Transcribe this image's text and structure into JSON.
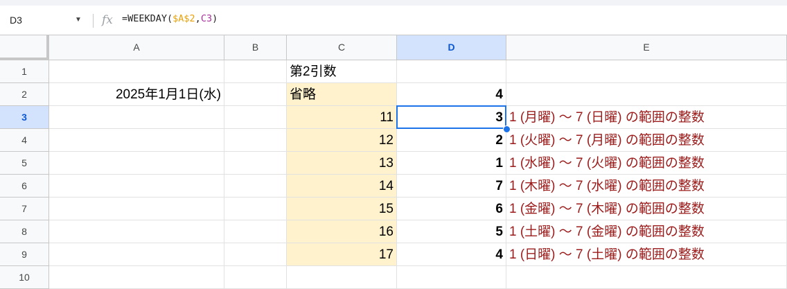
{
  "formula_bar": {
    "name_box": "D3",
    "fx_label": "fx",
    "formula_prefix": "=WEEKDAY(",
    "formula_ref1": "$A$2",
    "formula_comma": ",",
    "formula_ref2": "C3",
    "formula_suffix": ")"
  },
  "columns": [
    "A",
    "B",
    "C",
    "D",
    "E"
  ],
  "rows": [
    "1",
    "2",
    "3",
    "4",
    "5",
    "6",
    "7",
    "8",
    "9",
    "10"
  ],
  "cells": {
    "C1": "第2引数",
    "A2": "2025年1月1日(水)",
    "C2": "省略",
    "D2": "4",
    "C3": "11",
    "D3": "3",
    "E3": "1 (月曜) ～ 7 (日曜) の範囲の整数",
    "C4": "12",
    "D4": "2",
    "E4": "1 (火曜) ～ 7 (月曜) の範囲の整数",
    "C5": "13",
    "D5": "1",
    "E5": "1 (水曜) ～ 7 (火曜) の範囲の整数",
    "C6": "14",
    "D6": "7",
    "E6": "1 (木曜) ～ 7 (水曜) の範囲の整数",
    "C7": "15",
    "D7": "6",
    "E7": "1 (金曜) ～ 7 (木曜) の範囲の整数",
    "C8": "16",
    "D8": "5",
    "E8": "1 (土曜) ～ 7 (金曜) の範囲の整数",
    "C9": "17",
    "D9": "4",
    "E9": "1 (日曜) ～ 7 (土曜) の範囲の整数"
  },
  "selection": {
    "cell": "D3",
    "column": "D",
    "row": "3"
  },
  "colors": {
    "selection_border": "#1a73e8",
    "highlight_fill": "#fff2cc",
    "note_text": "#9b1b1b",
    "formula_underline": "#b0185f"
  }
}
